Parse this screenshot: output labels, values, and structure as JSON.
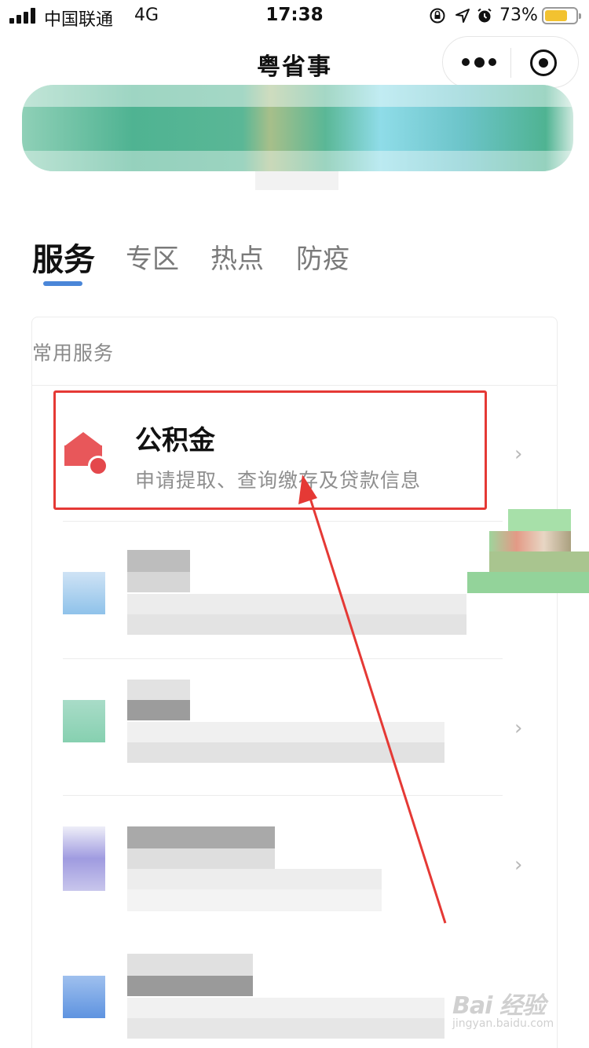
{
  "status_bar": {
    "carrier": "中国联通",
    "network": "4G",
    "time": "17:38",
    "battery_percent": "73%",
    "battery_level": 0.73,
    "icons": [
      "signal-icon",
      "orientation-lock-icon",
      "location-icon",
      "alarm-icon",
      "battery-icon"
    ]
  },
  "nav": {
    "title": "粤省事",
    "more_icon": "more-dots-icon",
    "close_icon": "target-close-icon"
  },
  "tabs": [
    {
      "label": "服务",
      "active": true
    },
    {
      "label": "专区",
      "active": false
    },
    {
      "label": "热点",
      "active": false
    },
    {
      "label": "防疫",
      "active": false
    }
  ],
  "section": {
    "title": "常用服务",
    "services": [
      {
        "title": "公积金",
        "subtitle": "申请提取、查询缴存及贷款信息",
        "icon": "housing-fund-icon",
        "highlighted": true
      }
    ]
  },
  "watermark": {
    "main": "Bai 经验",
    "sub": "jingyan.baidu.com"
  },
  "colors": {
    "accent": "#4a86d8",
    "highlight": "#e53935",
    "icon_red": "#e8575a"
  }
}
